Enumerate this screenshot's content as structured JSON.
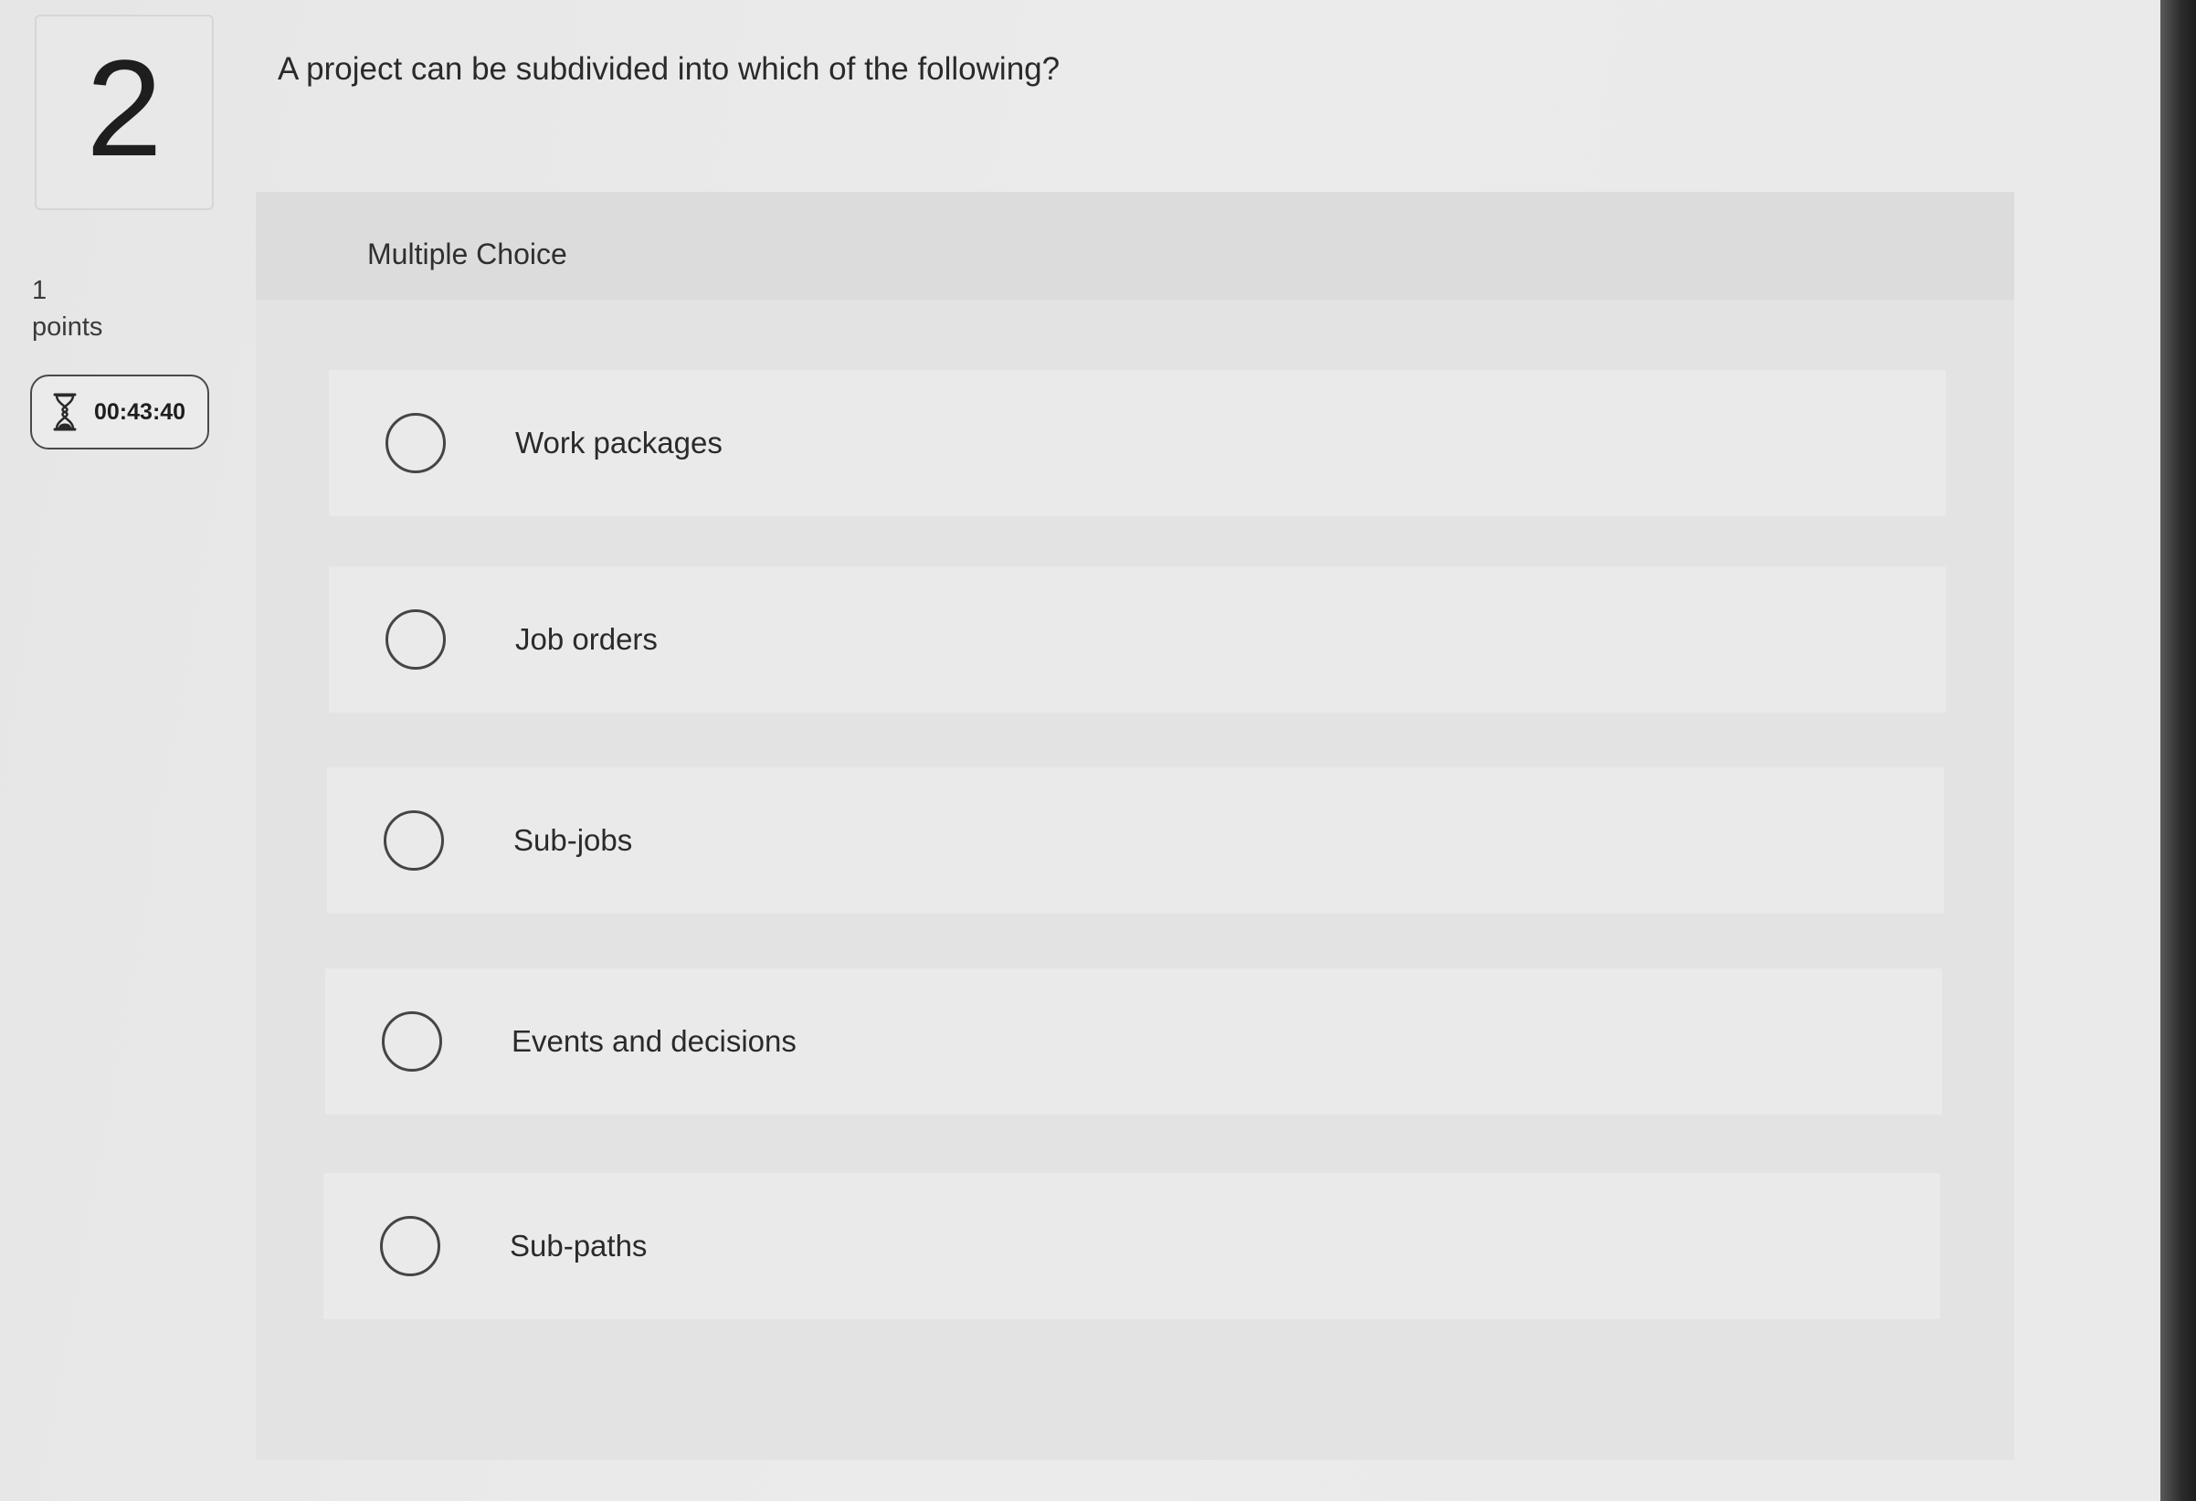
{
  "question_number": "2",
  "points": {
    "value": "1",
    "label": "points"
  },
  "timer": {
    "icon": "hourglass-icon",
    "value": "00:43:40"
  },
  "question": {
    "text": "A project can be subdivided into which of the following?"
  },
  "answer_panel": {
    "type_label": "Multiple Choice",
    "options": [
      {
        "label": "Work packages"
      },
      {
        "label": "Job orders"
      },
      {
        "label": "Sub-jobs"
      },
      {
        "label": "Events and decisions"
      },
      {
        "label": "Sub-paths"
      }
    ]
  }
}
